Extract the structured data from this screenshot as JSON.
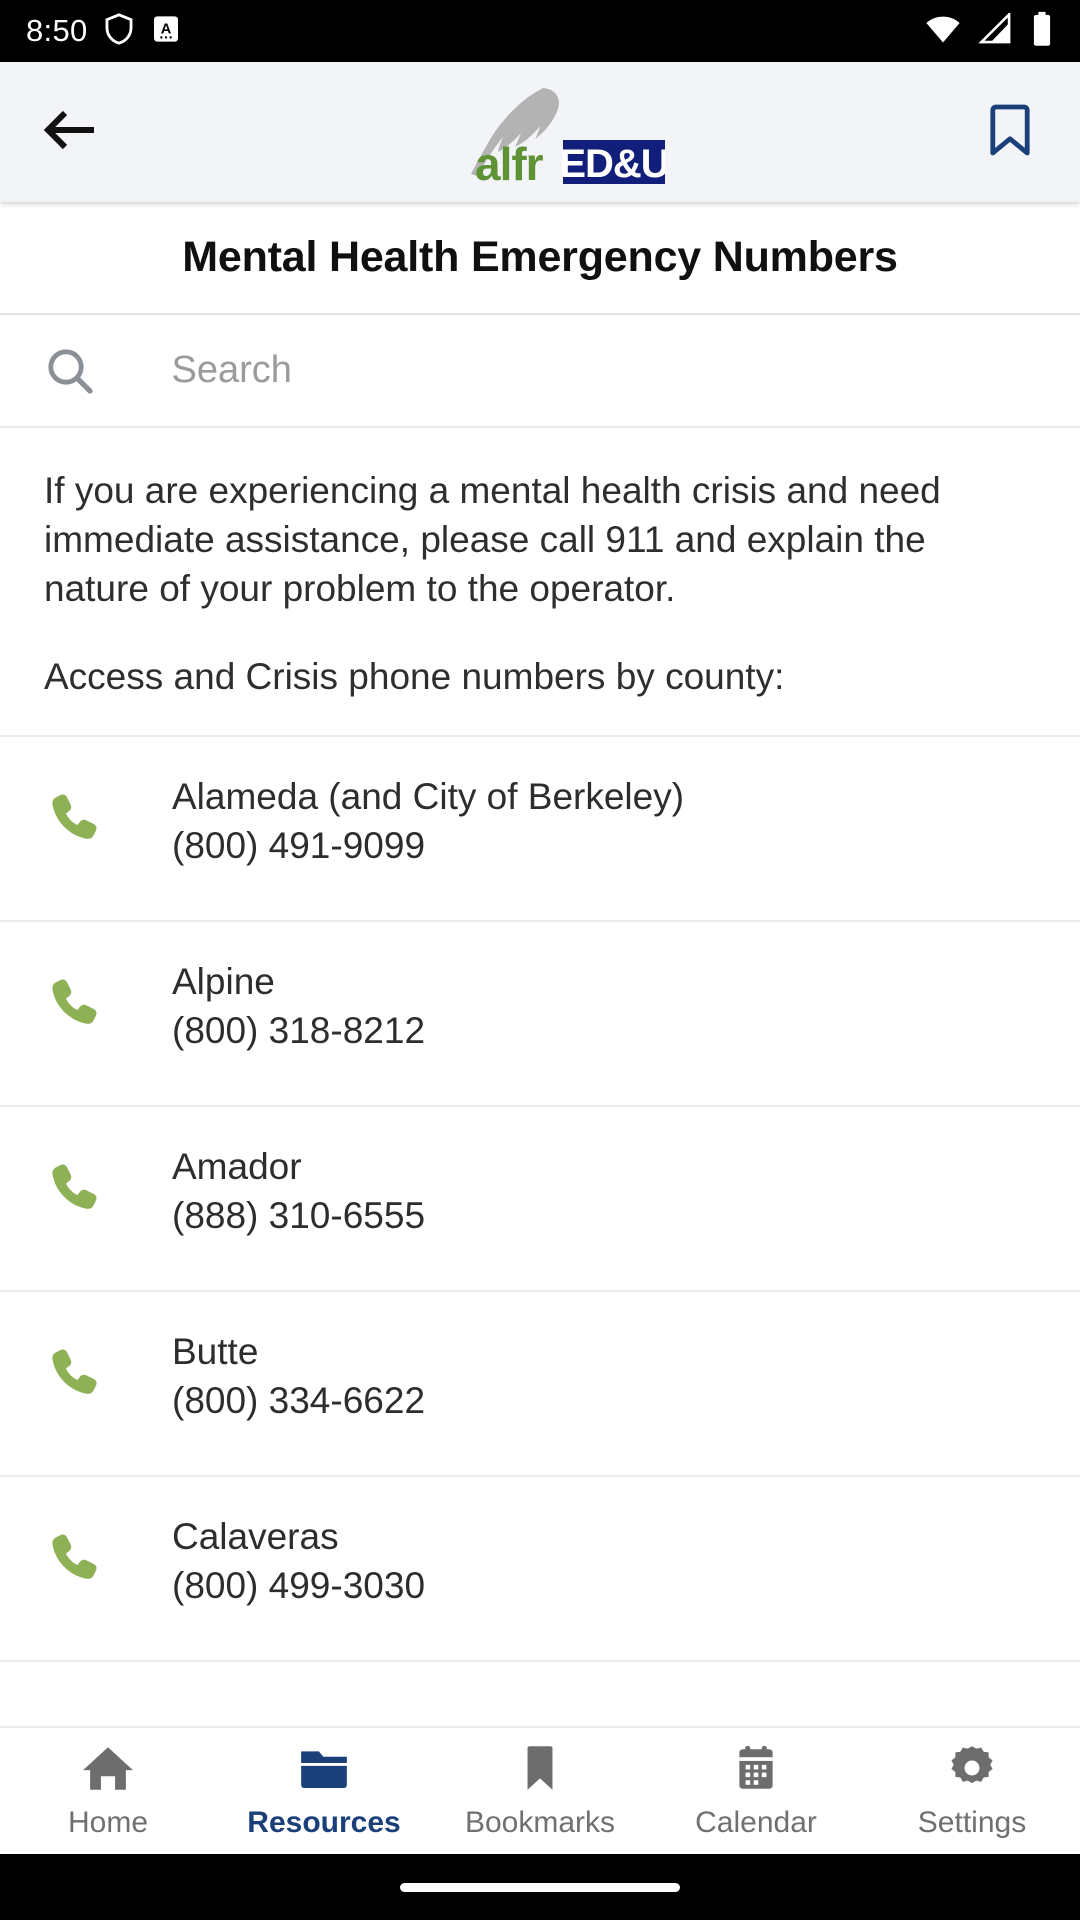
{
  "status_bar": {
    "time": "8:50",
    "left_icons": [
      "shield-icon",
      "a-badge-icon"
    ],
    "right_icons": [
      "wifi-icon",
      "cellular-signal-icon",
      "battery-icon"
    ],
    "background_color": "#000000"
  },
  "app_bar": {
    "back_icon": "back-arrow-icon",
    "bookmark_icon": "bookmark-icon",
    "bookmark_color": "#1b3f79",
    "logo": {
      "feather": "feather-quill-icon",
      "text_green": "alfr",
      "text_boxed": "ED&U",
      "green": "#5f9234",
      "navy": "#121f7a",
      "feather_gray": "#b3b3b3"
    },
    "background_color": "#f2f4f8"
  },
  "page": {
    "title": "Mental Health Emergency Numbers"
  },
  "search": {
    "icon": "search-icon",
    "placeholder": "Search",
    "value": ""
  },
  "intro": {
    "paragraph_1": "If you are experiencing a mental health crisis and need immediate assistance, please call 911 and explain the nature of your problem to the operator.",
    "paragraph_2": "Access and Crisis phone numbers by county:"
  },
  "contacts": {
    "icon": "phone-icon",
    "icon_color": "#8fb156",
    "items": [
      {
        "county": "Alameda (and City of Berkeley)",
        "number": "(800) 491-9099"
      },
      {
        "county": "Alpine",
        "number": "(800) 318-8212"
      },
      {
        "county": "Amador",
        "number": "(888) 310-6555"
      },
      {
        "county": "Butte",
        "number": "(800) 334-6622"
      },
      {
        "county": "Calaveras",
        "number": "(800) 499-3030"
      }
    ]
  },
  "bottom_nav": {
    "active_color": "#1b3f79",
    "inactive_color": "#707070",
    "items": [
      {
        "label": "Home",
        "icon": "home-icon",
        "active": false
      },
      {
        "label": "Resources",
        "icon": "folder-icon",
        "active": true
      },
      {
        "label": "Bookmarks",
        "icon": "bookmark-icon",
        "active": false
      },
      {
        "label": "Calendar",
        "icon": "calendar-icon",
        "active": false
      },
      {
        "label": "Settings",
        "icon": "gear-icon",
        "active": false
      }
    ]
  }
}
